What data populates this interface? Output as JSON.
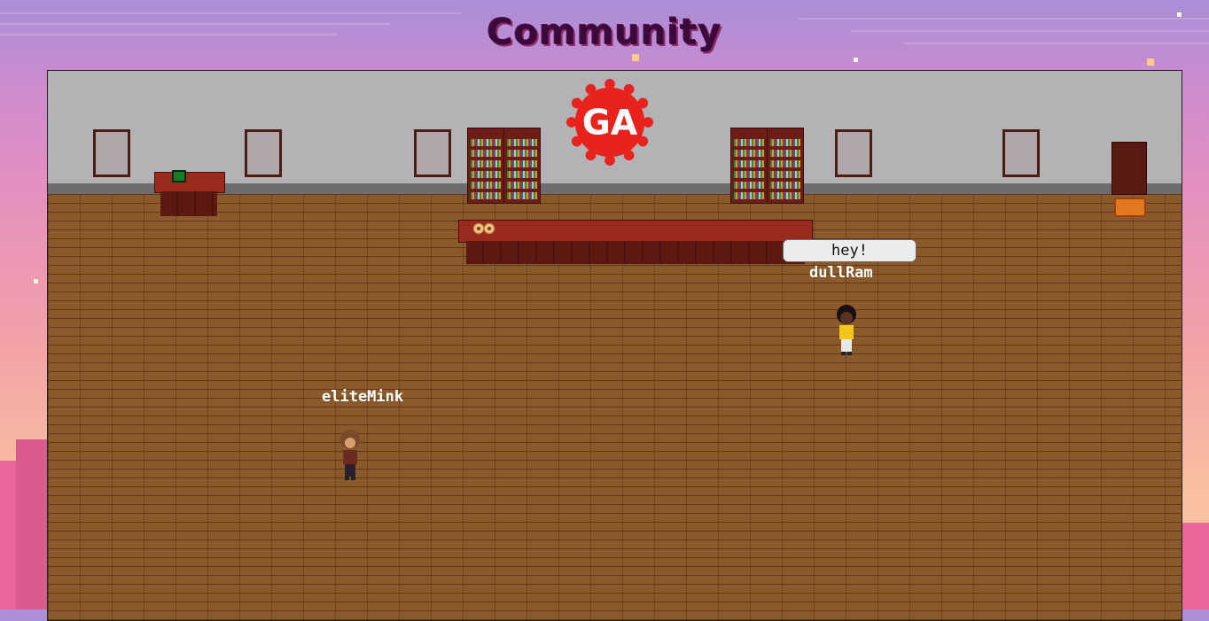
{
  "page": {
    "title": "Community"
  },
  "room": {
    "logo_text": "GA",
    "colors": {
      "logo": "#e8231e",
      "wall": "#b3b3b6",
      "floor": "#8a5a2a"
    }
  },
  "players": [
    {
      "name": "dullRam",
      "chat": "hey!"
    },
    {
      "name": "eliteMink",
      "chat": ""
    }
  ]
}
